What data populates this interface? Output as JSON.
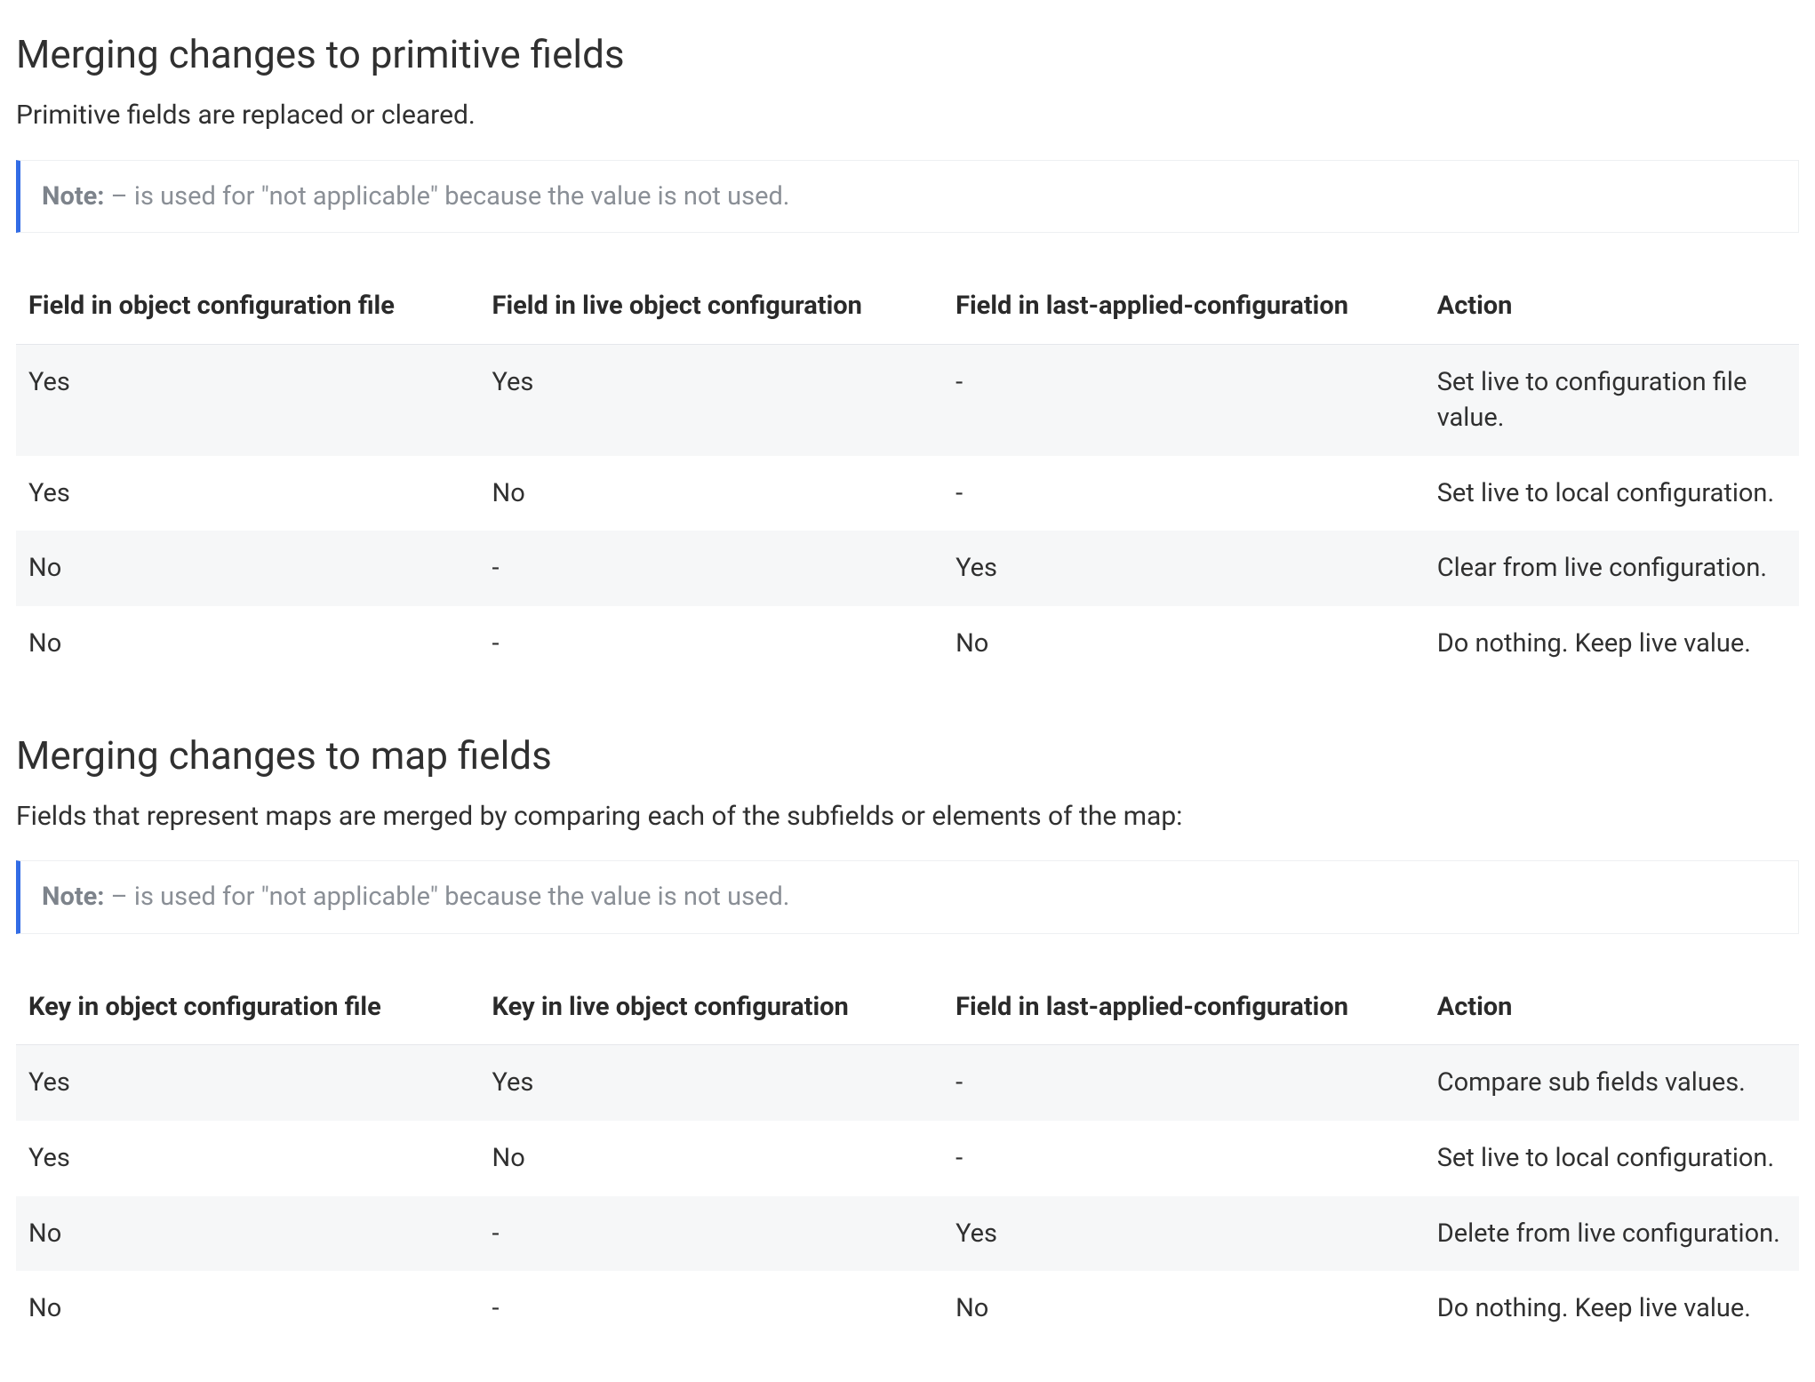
{
  "sections": {
    "primitive": {
      "heading": "Merging changes to primitive fields",
      "intro": "Primitive fields are replaced or cleared.",
      "note_label": "Note:",
      "note_body": " – is used for \"not applicable\" because the value is not used.",
      "table": {
        "headers": [
          "Field in object configuration file",
          "Field in live object configuration",
          "Field in last-applied-configuration",
          "Action"
        ],
        "rows": [
          [
            "Yes",
            "Yes",
            "-",
            "Set live to configuration file value."
          ],
          [
            "Yes",
            "No",
            "-",
            "Set live to local configuration."
          ],
          [
            "No",
            "-",
            "Yes",
            "Clear from live configuration."
          ],
          [
            "No",
            "-",
            "No",
            "Do nothing. Keep live value."
          ]
        ]
      }
    },
    "map": {
      "heading": "Merging changes to map fields",
      "intro": "Fields that represent maps are merged by comparing each of the subfields or elements of the map:",
      "note_label": "Note:",
      "note_body": " – is used for \"not applicable\" because the value is not used.",
      "table": {
        "headers": [
          "Key in object configuration file",
          "Key in live object configuration",
          "Field in last-applied-configuration",
          "Action"
        ],
        "rows": [
          [
            "Yes",
            "Yes",
            "-",
            "Compare sub fields values."
          ],
          [
            "Yes",
            "No",
            "-",
            "Set live to local configuration."
          ],
          [
            "No",
            "-",
            "Yes",
            "Delete from live configuration."
          ],
          [
            "No",
            "-",
            "No",
            "Do nothing. Keep live value."
          ]
        ]
      }
    }
  }
}
